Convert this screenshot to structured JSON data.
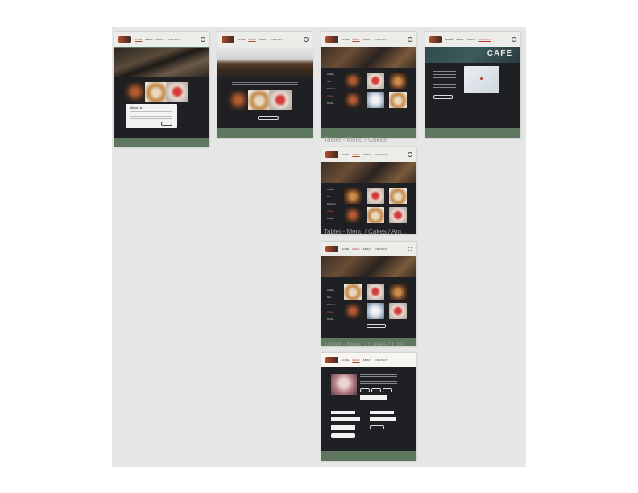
{
  "nav": {
    "items": [
      "HOME",
      "MENU",
      "ABOUT",
      "CONTACT"
    ]
  },
  "labels": {
    "tablet_menu_cakes": "Tablet - Menu / Cakes",
    "tablet_menu_cakes_2": "Tablet - Menu / Cakes / Am...",
    "tablet_menu_cakes_3": "Tablet - Menu / Cakes / Cust..."
  },
  "home": {
    "about_title": "About Us"
  },
  "contact": {
    "cafe_sign": "CAFE"
  },
  "menu": {
    "side_items": [
      "Coffee",
      "Tea",
      "Pastries",
      "Cakes",
      "Drinks"
    ]
  },
  "colors": {
    "canvas_bg": "#e6e6e6",
    "header_bg": "#ecece8",
    "body_bg": "#1f2023",
    "footer_bg": "#5f775f",
    "accent": "#b43a2a"
  }
}
